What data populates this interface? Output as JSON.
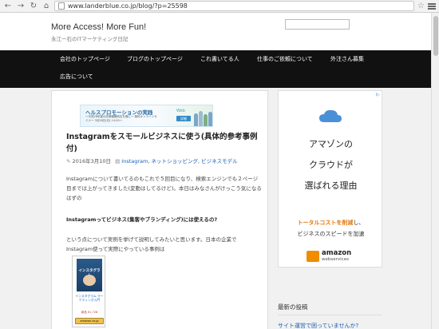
{
  "browser": {
    "url": "www.landerblue.co.jp/blog/?p=25598"
  },
  "header": {
    "site_title": "More Access! More Fun!",
    "site_description": "永江一石のITマーケティング日記"
  },
  "nav": {
    "items": [
      "会社のトップページ",
      "ブログのトップページ",
      "これ書いてる人",
      "仕事のご依頼について",
      "外注さん募集",
      "広告について"
    ]
  },
  "ad_banner": {
    "title": "ヘルスプロモーションの実践",
    "subtitle": "〜平成28年度の診療報酬改定を機に〜 無料オンラインセミナー 3月28日(月) 14:00〜",
    "logo": "Web",
    "button": "詳細"
  },
  "post": {
    "title": "Instagramをスモールビジネスに使う(具体的参考事例付)",
    "date": "2016年3月10日",
    "categories": [
      "Instagram",
      "ネットショッピング",
      "ビジネスモデル"
    ],
    "paragraph1": "Instagramについて書いてるのもこれで５回目になり、検索エンジンでも２ページ目までは上がってきました(変動はしてるけど)。本日はみなさんがけっこう気になるはずの",
    "heading": "Instagramってビジネス(集客やブランディング)には使えるの?",
    "paragraph2": "という点について実例を挙げて説明してみたいと思います。日本の企業でInstagram使って実際にやっている事例は",
    "book": {
      "cover_title": "インスタグラム",
      "link": "インスタグラム マーケティング入門",
      "price": "新品 ¥1,728",
      "button": "amazon.co.jp"
    }
  },
  "sidebar_ad": {
    "line1": "アマゾンの",
    "line2": "クラウドが",
    "line3": "選ばれる理由",
    "line4_highlight": "トータルコストを削減",
    "line4_rest": "し、",
    "line5": "ビジネスのスピードを加速",
    "brand": "amazon",
    "brand_sub": "webservices",
    "ad_tag": "i▷"
  },
  "recent": {
    "heading": "最新の投稿",
    "first_item": "サイト運営で困っていませんか?"
  }
}
